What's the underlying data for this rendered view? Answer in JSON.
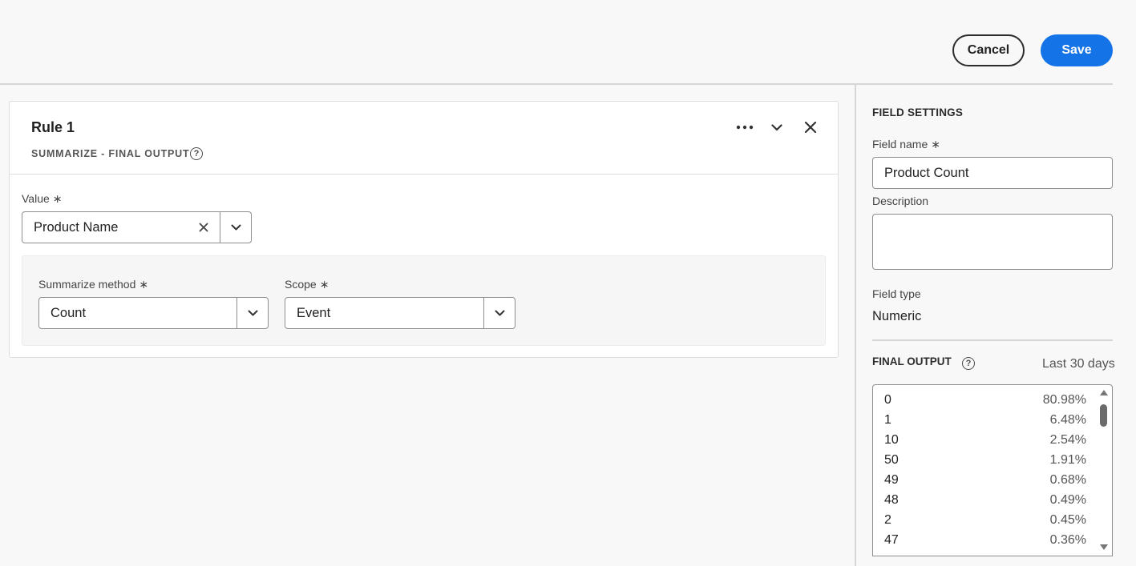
{
  "header": {
    "cancel_label": "Cancel",
    "save_label": "Save"
  },
  "rule": {
    "title": "Rule 1",
    "subtitle": "SUMMARIZE - FINAL OUTPUT",
    "value_label": "Value",
    "value_selected": "Product Name",
    "summarize_method_label": "Summarize method",
    "summarize_method_selected": "Count",
    "scope_label": "Scope",
    "scope_selected": "Event",
    "required_marker": "∗"
  },
  "field_settings": {
    "title": "FIELD SETTINGS",
    "field_name_label": "Field name",
    "field_name_value": "Product Count",
    "description_label": "Description",
    "description_value": "",
    "field_type_label": "Field type",
    "field_type_value": "Numeric"
  },
  "final_output": {
    "title": "FINAL OUTPUT",
    "range": "Last 30 days",
    "rows": [
      {
        "value": "0",
        "percent": "80.98%"
      },
      {
        "value": "1",
        "percent": "6.48%"
      },
      {
        "value": "10",
        "percent": "2.54%"
      },
      {
        "value": "50",
        "percent": "1.91%"
      },
      {
        "value": "49",
        "percent": "0.68%"
      },
      {
        "value": "48",
        "percent": "0.49%"
      },
      {
        "value": "2",
        "percent": "0.45%"
      },
      {
        "value": "47",
        "percent": "0.36%"
      }
    ]
  },
  "colors": {
    "accent": "#1473e6",
    "background": "#f8f8f8"
  }
}
